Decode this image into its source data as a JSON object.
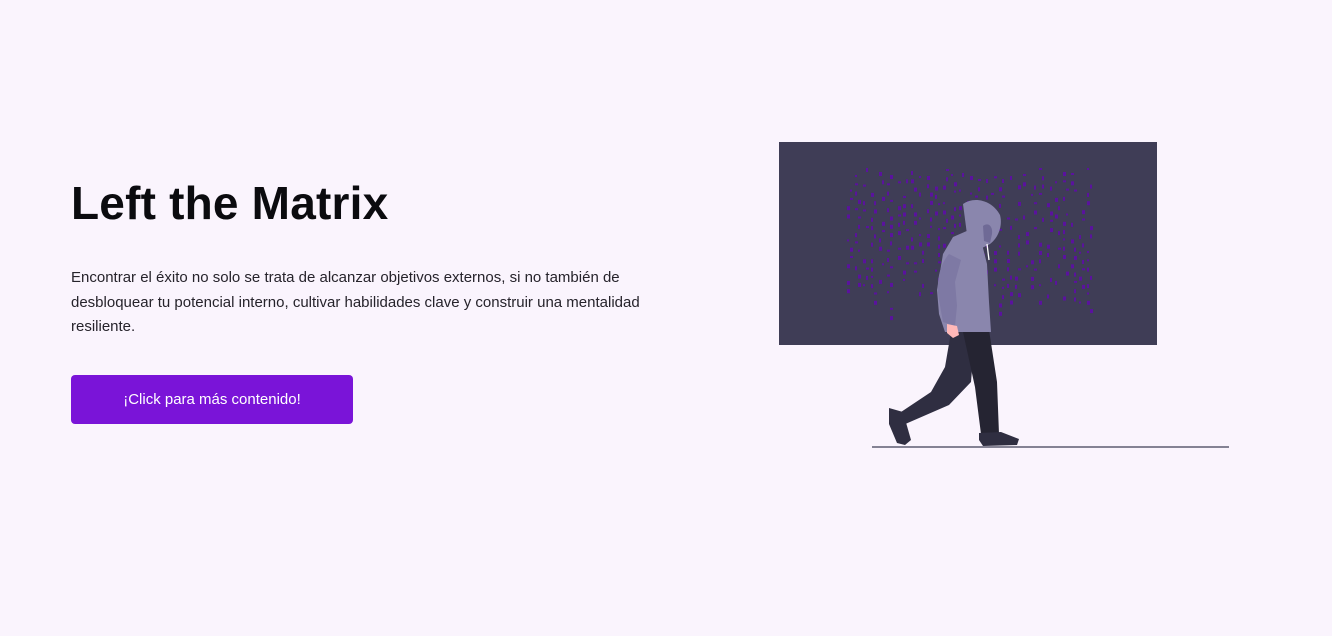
{
  "hero": {
    "title": "Left the Matrix",
    "description": "Encontrar el éxito no solo se trata de alcanzar objetivos externos, si no también de desbloquear tu potencial interno, cultivar habilidades clave y construir una mentalidad resiliente.",
    "cta_label": "¡Click para más contenido!"
  },
  "colors": {
    "background": "#faf4fd",
    "accent": "#7a14d8",
    "screen": "#3f3d56",
    "code_glyph": "#5a129e",
    "hoodie": "#8a86ad",
    "pants": "#2f2e41"
  }
}
